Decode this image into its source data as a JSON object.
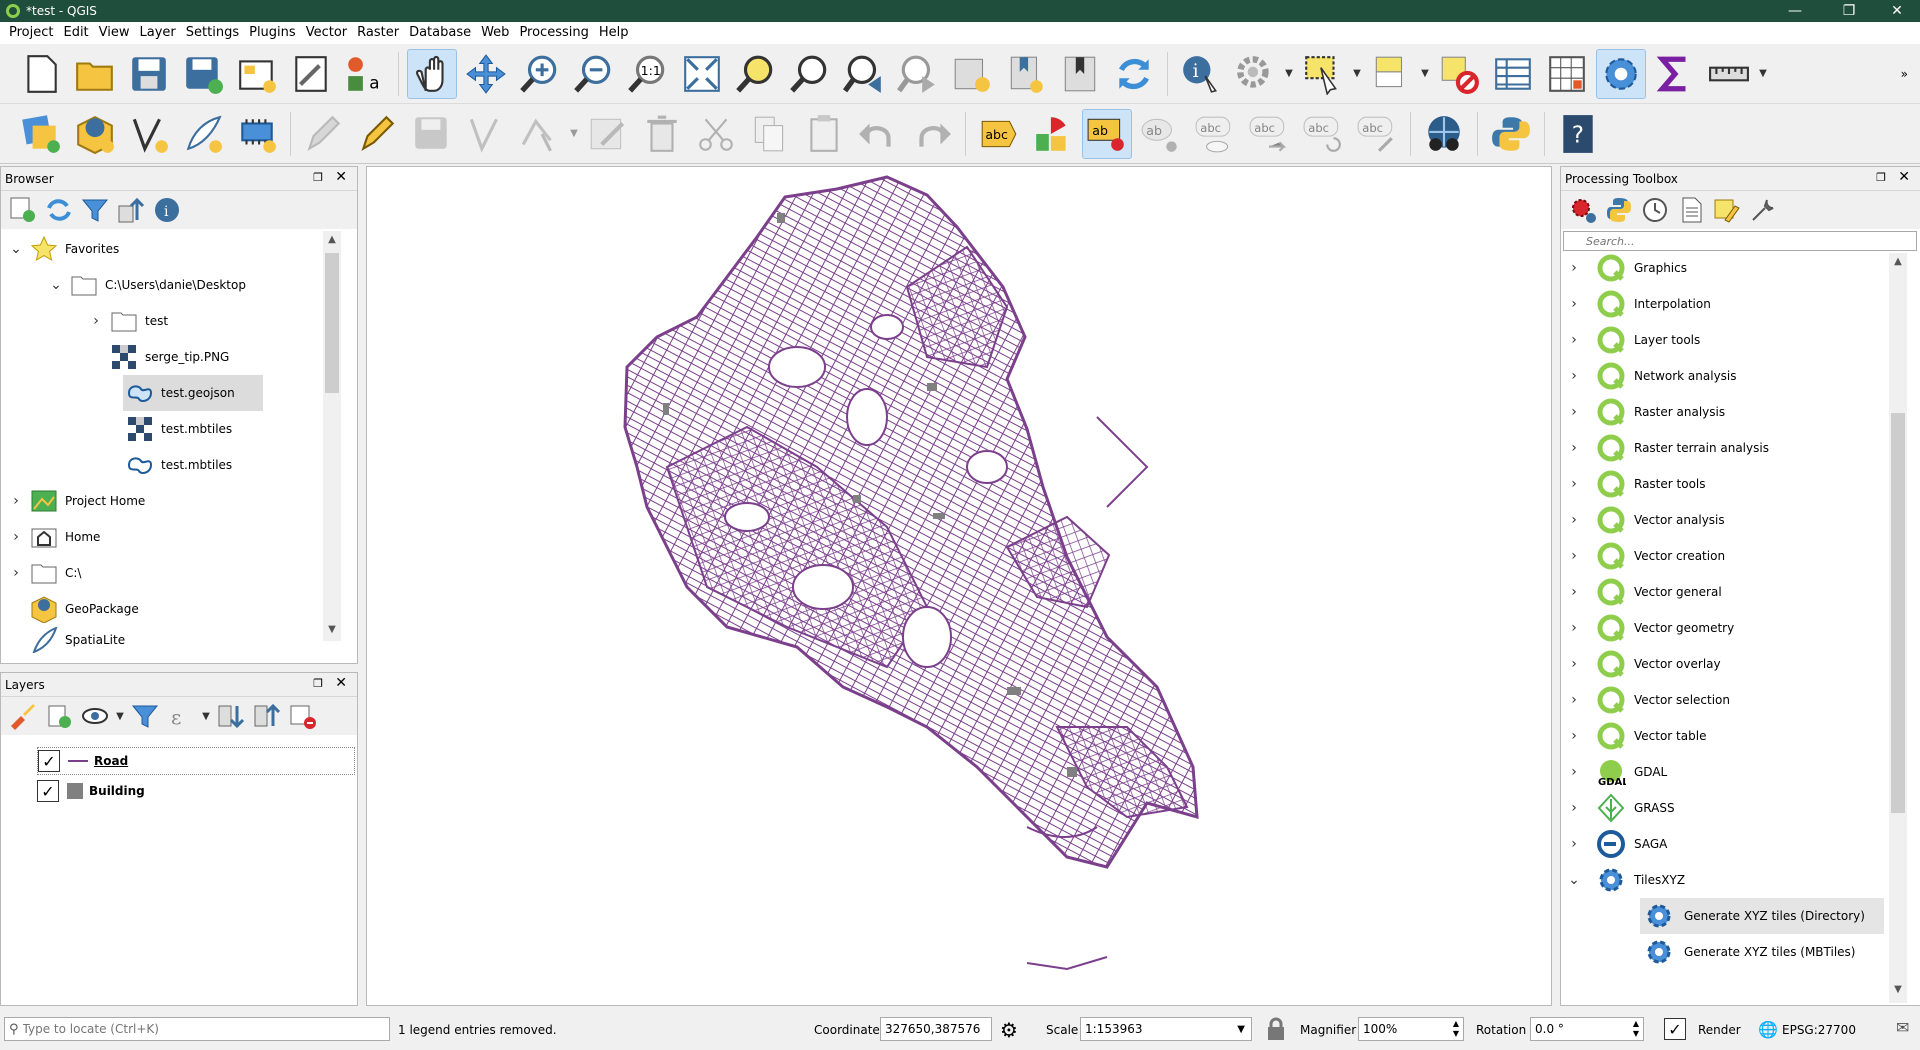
{
  "window": {
    "title": "*test - QGIS"
  },
  "menu": [
    "Project",
    "Edit",
    "View",
    "Layer",
    "Settings",
    "Plugins",
    "Vector",
    "Raster",
    "Database",
    "Web",
    "Processing",
    "Help"
  ],
  "colors": {
    "road": "#7b3f8c",
    "building": "#808080",
    "titlebar": "#1f4e3d",
    "selection": "#cde3f7"
  },
  "browser": {
    "title": "Browser",
    "items": [
      {
        "label": "Favorites",
        "icon": "star-icon",
        "expanded": true
      },
      {
        "label": "C:\\Users\\danie\\Desktop",
        "icon": "folder-icon",
        "expanded": true
      },
      {
        "label": "test",
        "icon": "folder-icon"
      },
      {
        "label": "serge_tip.PNG",
        "icon": "raster-icon"
      },
      {
        "label": "test.geojson",
        "icon": "vector-icon",
        "selected": true
      },
      {
        "label": "test.mbtiles",
        "icon": "raster-icon"
      },
      {
        "label": "test.mbtiles",
        "icon": "vector-icon"
      },
      {
        "label": "Project Home",
        "icon": "project-home-icon"
      },
      {
        "label": "Home",
        "icon": "home-icon"
      },
      {
        "label": "C:\\",
        "icon": "drive-icon"
      },
      {
        "label": "GeoPackage",
        "icon": "geopackage-icon"
      },
      {
        "label": "SpatiaLite",
        "icon": "spatialite-icon"
      }
    ]
  },
  "layers": {
    "title": "Layers",
    "items": [
      {
        "label": "Road",
        "checked": true,
        "symbol": "line"
      },
      {
        "label": "Building",
        "checked": true,
        "symbol": "fill"
      }
    ]
  },
  "processing": {
    "title": "Processing Toolbox",
    "search_placeholder": "Search...",
    "groups": [
      "Graphics",
      "Interpolation",
      "Layer tools",
      "Network analysis",
      "Raster analysis",
      "Raster terrain analysis",
      "Raster tools",
      "Vector analysis",
      "Vector creation",
      "Vector general",
      "Vector geometry",
      "Vector overlay",
      "Vector selection",
      "Vector table"
    ],
    "providers": [
      {
        "label": "GDAL",
        "icon": "gdal-icon"
      },
      {
        "label": "GRASS",
        "icon": "grass-icon"
      },
      {
        "label": "SAGA",
        "icon": "saga-icon"
      },
      {
        "label": "TilesXYZ",
        "icon": "gear-icon",
        "expanded": true
      }
    ],
    "algorithms": [
      "Generate XYZ tiles (Directory)",
      "Generate XYZ tiles (MBTiles)"
    ]
  },
  "status": {
    "locate_placeholder": "Type to locate (Ctrl+K)",
    "message": "1 legend entries removed.",
    "coordinate_label": "Coordinate",
    "coordinate_value": "327650,387576",
    "scale_label": "Scale",
    "scale_value": "1:153963",
    "magnifier_label": "Magnifier",
    "magnifier_value": "100%",
    "rotation_label": "Rotation",
    "rotation_value": "0.0 °",
    "render_label": "Render",
    "crs_label": "EPSG:27700"
  }
}
